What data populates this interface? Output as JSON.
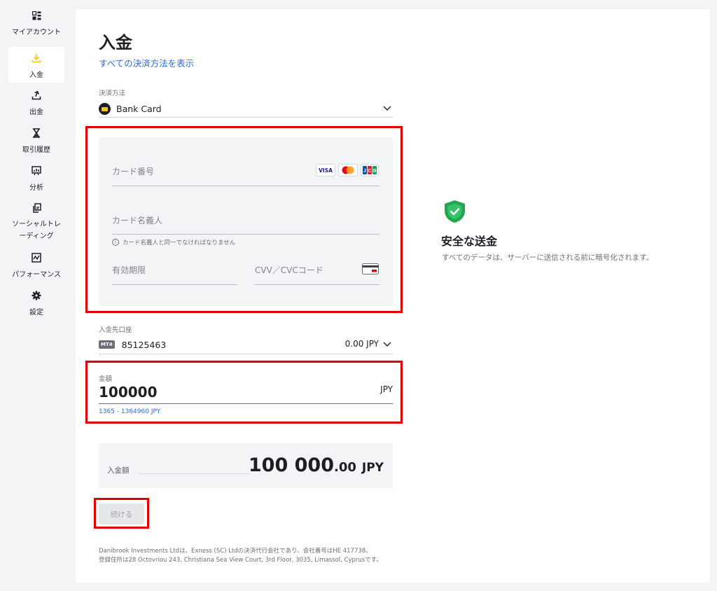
{
  "sidebar": {
    "items": [
      {
        "label": "マイアカウント",
        "icon": "dashboard-icon"
      },
      {
        "label": "入金",
        "icon": "deposit-icon",
        "active": true
      },
      {
        "label": "出金",
        "icon": "withdraw-icon"
      },
      {
        "label": "取引履歴",
        "icon": "hourglass-icon"
      },
      {
        "label": "分析",
        "icon": "analytics-icon"
      },
      {
        "label": "ソーシャルトレーディング",
        "icon": "copy-trading-icon"
      },
      {
        "label": "パフォーマンス",
        "icon": "performance-icon"
      },
      {
        "label": "設定",
        "icon": "gear-icon"
      }
    ]
  },
  "page": {
    "title": "入金",
    "all_methods_link": "すべての決済方法を表示"
  },
  "payment_method": {
    "label": "決済方法",
    "value": "Bank Card"
  },
  "card_form": {
    "card_number_placeholder": "カード番号",
    "brands": [
      "VISA",
      "Mastercard",
      "JCB"
    ],
    "holder_placeholder": "カード名義人",
    "holder_hint": "カード名義人と同一でなければなりません",
    "expiry_placeholder": "有効期限",
    "cvv_placeholder": "CVV／CVCコード"
  },
  "account": {
    "label": "入金先口座",
    "platform_badge": "MT4",
    "number": "85125463",
    "balance": "0.00 JPY"
  },
  "amount": {
    "label": "金額",
    "value": "100000",
    "currency": "JPY",
    "range": "1365 - 1364960 JPY"
  },
  "summary": {
    "label": "入金額",
    "integer": "100 000",
    "decimal": ".00",
    "currency": "JPY"
  },
  "actions": {
    "continue_label": "続ける"
  },
  "footer_lines": [
    "Danibrook Investments Ltdは、Exness (SC) Ltdの決済代行会社であり、会社番号はHE 417738、",
    "登録住所は28 Octovriou 243, Christiana Sea View Court, 3rd Floor, 3035, Limassol, Cyprusです。"
  ],
  "secure": {
    "title": "安全な送金",
    "subtitle": "すべてのデータは、サーバーに送信される前に暗号化されます。"
  },
  "colors": {
    "highlight_border": "#e00000",
    "link": "#2c6cd6",
    "shield_green": "#1fa84f",
    "active_icon": "#f5c518"
  }
}
